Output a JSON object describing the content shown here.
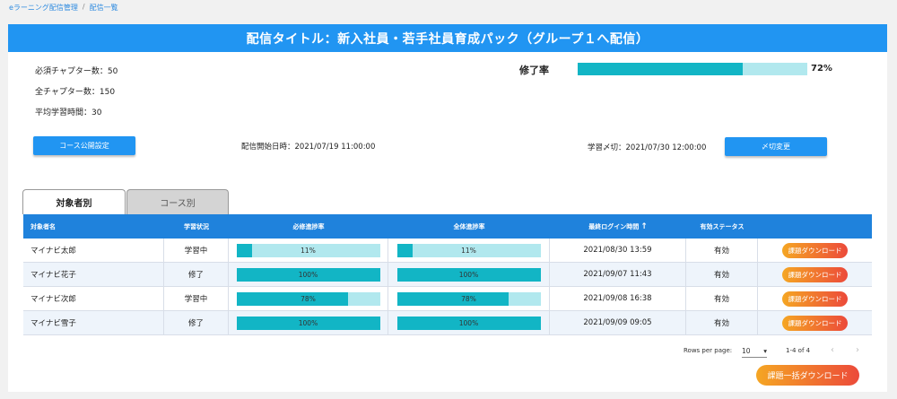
{
  "breadcrumb": {
    "parent": "eラーニング配信管理",
    "separator": "/",
    "current": "配信一覧"
  },
  "title": "配信タイトル：新入社員・若手社員育成パック（グループ１へ配信）",
  "stats": {
    "required_chapters": "必須チャプター数：50",
    "total_chapters": "全チャプター数：150",
    "avg_study_time": "平均学習時間：30"
  },
  "completion": {
    "label": "修了率",
    "value_text": "72%",
    "value": 72
  },
  "buttons": {
    "course_settings": "コース公開設定",
    "deadline_change": "〆切変更",
    "bulk_download": "課題一括ダウンロード"
  },
  "dates": {
    "start": "配信開始日時：2021/07/19 11:00:00",
    "deadline": "学習〆切：2021/07/30 12:00:00"
  },
  "tabs": [
    {
      "label": "対象者別"
    },
    {
      "label": "コース別"
    }
  ],
  "table": {
    "headers": [
      "対象者名",
      "学習状況",
      "必修進捗率",
      "全体進捗率",
      "最終ログイン時間",
      "有効ステータス",
      ""
    ],
    "sort_icon": "arrow-up-icon",
    "rows": [
      {
        "name": "マイナビ太郎",
        "status": "学習中",
        "req_pct_text": "11%",
        "req_pct": 11,
        "all_pct_text": "11%",
        "all_pct": 11,
        "last_login": "2021/08/30 13:59",
        "valid": "有効",
        "action": "課題ダウンロード"
      },
      {
        "name": "マイナビ花子",
        "status": "修了",
        "req_pct_text": "100%",
        "req_pct": 100,
        "all_pct_text": "100%",
        "all_pct": 100,
        "last_login": "2021/09/07 11:43",
        "valid": "有効",
        "action": "課題ダウンロード"
      },
      {
        "name": "マイナビ次郎",
        "status": "学習中",
        "req_pct_text": "78%",
        "req_pct": 78,
        "all_pct_text": "78%",
        "all_pct": 78,
        "last_login": "2021/09/08 16:38",
        "valid": "有効",
        "action": "課題ダウンロード"
      },
      {
        "name": "マイナビ雪子",
        "status": "修了",
        "req_pct_text": "100%",
        "req_pct": 100,
        "all_pct_text": "100%",
        "all_pct": 100,
        "last_login": "2021/09/09 09:05",
        "valid": "有効",
        "action": "課題ダウンロード"
      }
    ]
  },
  "pagination": {
    "rows_per_page_label": "Rows per page:",
    "rows_per_page": "10",
    "range": "1-4 of 4",
    "prev_icon": "chevron-left-icon",
    "next_icon": "chevron-right-icon"
  },
  "colors": {
    "primary": "#2195f2",
    "table_header": "#1f82dc",
    "progress_fill": "#12b5c5",
    "progress_track": "#b1e8ee",
    "orange_start": "#f5a623",
    "orange_end": "#ec4a3a"
  }
}
